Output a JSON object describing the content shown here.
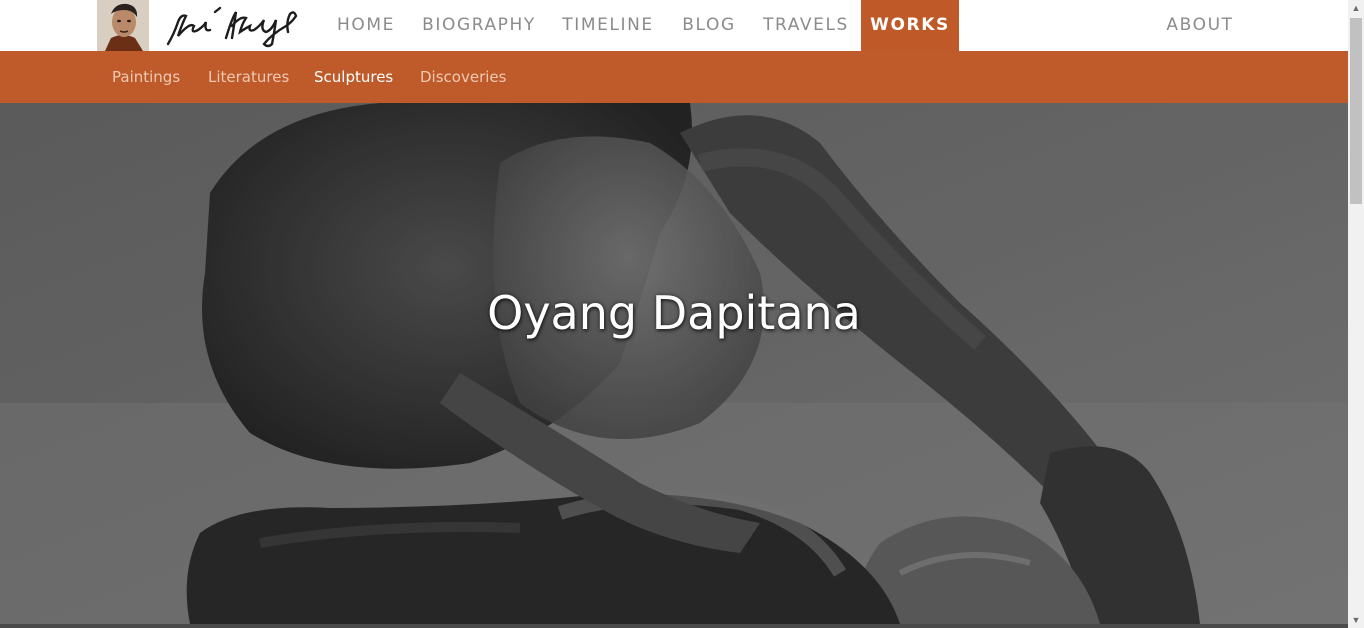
{
  "brand": {
    "logo_alt_name": "portrait-logo",
    "signature_icon": "signature-icon"
  },
  "nav": {
    "items": [
      {
        "label": "HOME"
      },
      {
        "label": "BIOGRAPHY"
      },
      {
        "label": "TIMELINE"
      },
      {
        "label": "BLOG"
      },
      {
        "label": "TRAVELS"
      },
      {
        "label": "WORKS",
        "active": true
      },
      {
        "label": "ABOUT"
      }
    ]
  },
  "subnav": {
    "items": [
      {
        "label": "Paintings"
      },
      {
        "label": "Literatures"
      },
      {
        "label": "Sculptures",
        "active": true
      },
      {
        "label": "Discoveries"
      }
    ]
  },
  "hero": {
    "title": "Oyang Dapitana"
  },
  "colors": {
    "accent": "#bf5a28",
    "nav_text": "#8b8b8b",
    "subnav_text": "#f0c9b2"
  }
}
